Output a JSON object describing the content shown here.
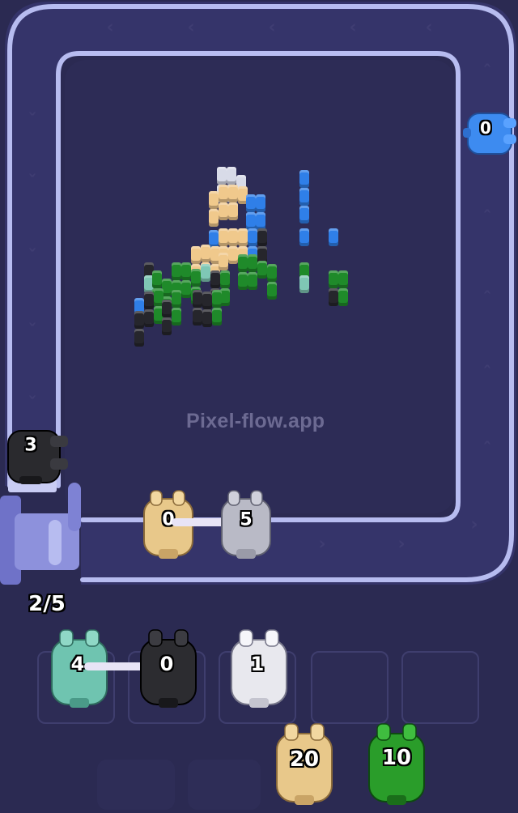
{
  "watermark": "Pixel-flow.app",
  "capacity": "2/5",
  "track": {
    "blue_shooter": {
      "count": "0",
      "color": "#3d8bf0"
    },
    "black_shooter_left": {
      "count": "3",
      "color": "#2a2a2e"
    },
    "tan_shooter": {
      "count": "0",
      "color": "#e8c88a"
    },
    "gray_shooter": {
      "count": "5",
      "color": "#b9bac6"
    }
  },
  "slots": [
    {
      "count": "4",
      "color": "#6fc4b0",
      "filled": true
    },
    {
      "count": "0",
      "color": "#2c2c30",
      "filled": true
    },
    {
      "count": "1",
      "color": "#e8e8ee",
      "filled": true
    },
    {
      "count": "",
      "filled": false
    },
    {
      "count": "",
      "filled": false
    }
  ],
  "queue": [
    {
      "count": "20",
      "color": "#e8c88a"
    },
    {
      "count": "10",
      "color": "#2a9d2a"
    }
  ],
  "pixel_colors": {
    "blue": "#2f7fe8",
    "tan": "#f0c98c",
    "white": "#d8dbe8",
    "green": "#1f8a2a",
    "black": "#26262c",
    "teal": "#7fc7b5"
  }
}
